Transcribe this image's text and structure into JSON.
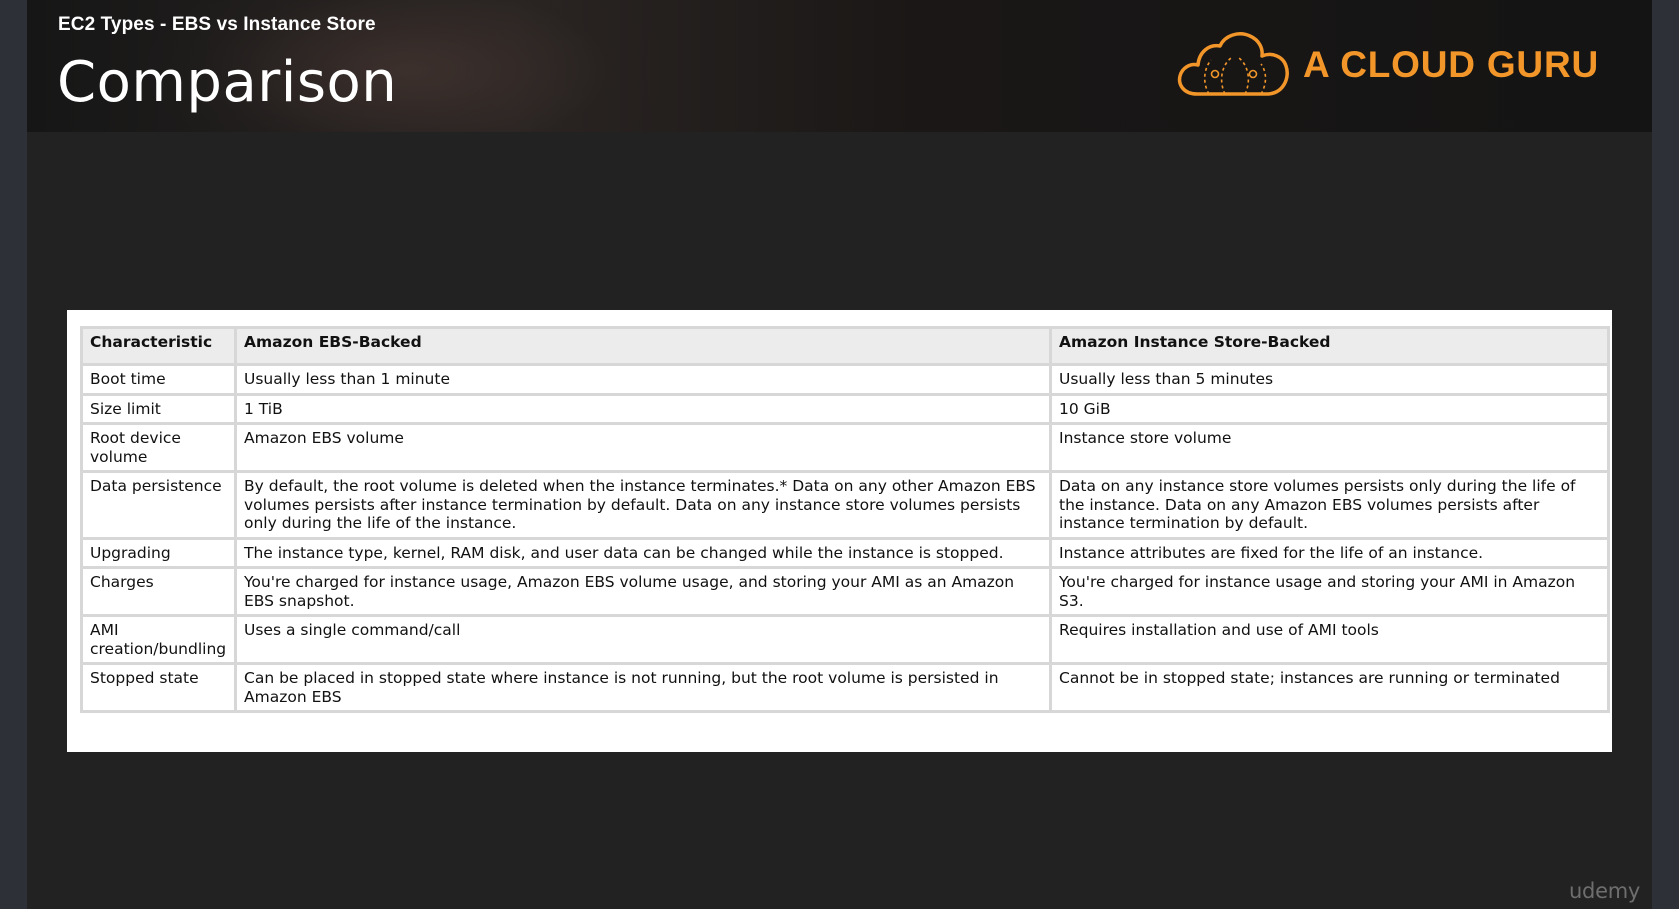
{
  "header": {
    "subtitle": "EC2 Types - EBS vs Instance Store",
    "title": "Comparison",
    "logo_text": "A CLOUD GURU"
  },
  "table": {
    "columns": [
      "Characteristic",
      "Amazon EBS-Backed",
      "Amazon Instance Store-Backed"
    ],
    "rows": [
      [
        "Boot time",
        "Usually less than 1 minute",
        "Usually less than 5 minutes"
      ],
      [
        "Size limit",
        "1 TiB",
        "10 GiB"
      ],
      [
        "Root device volume",
        "Amazon EBS volume",
        "Instance store volume"
      ],
      [
        "Data persistence",
        "By default, the root volume is deleted when the instance terminates.* Data on any other Amazon EBS volumes persists after instance termination by default. Data on any instance store volumes persists only during the life of the instance.",
        "Data on any instance store volumes persists only during the life of the instance. Data on any Amazon EBS volumes persists after instance termination by default."
      ],
      [
        "Upgrading",
        "The instance type, kernel, RAM disk, and user data can be changed while the instance is stopped.",
        "Instance attributes are fixed for the life of an instance."
      ],
      [
        "Charges",
        "You're charged for instance usage, Amazon EBS volume usage, and storing your AMI as an Amazon EBS snapshot.",
        "You're charged for instance usage and storing your AMI in Amazon S3."
      ],
      [
        "AMI creation/bundling",
        "Uses a single command/call",
        "Requires installation and use of AMI tools"
      ],
      [
        "Stopped state",
        "Can be placed in stopped state where instance is not running, but the root volume is persisted in Amazon EBS",
        "Cannot be in stopped state; instances are running or terminated"
      ]
    ]
  },
  "watermark": "udemy",
  "colors": {
    "brand_orange": "#f2962a",
    "slide_background": "#222222",
    "table_header": "#ececec",
    "table_border": "#d7d7d7"
  }
}
